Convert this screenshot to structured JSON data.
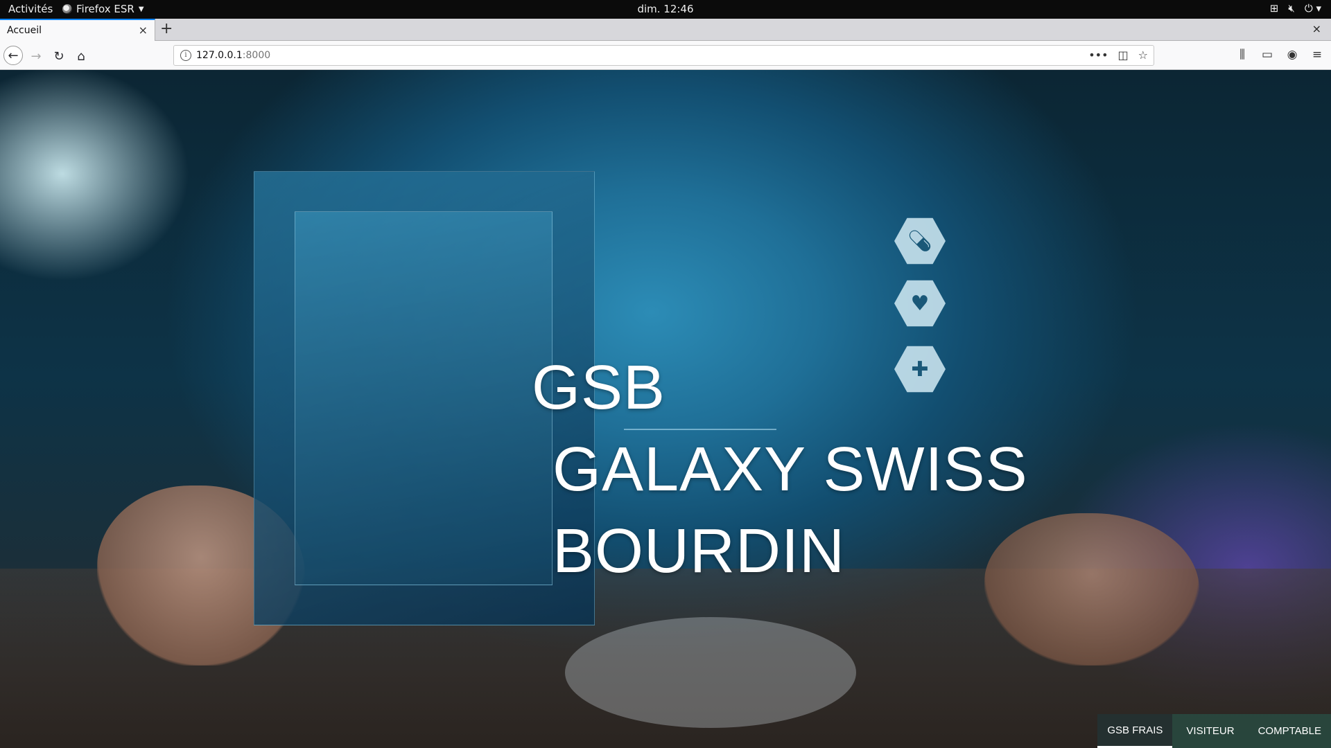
{
  "topbar": {
    "activities": "Activités",
    "app_name": "Firefox ESR",
    "clock": "dim. 12:46",
    "icons": [
      "network-icon",
      "volume-muted-icon",
      "power-icon"
    ]
  },
  "browser": {
    "tab_title": "Accueil",
    "url_host": "127.0.0.1",
    "url_port": ":8000",
    "new_tab": "+",
    "close_glyph": "×"
  },
  "hero": {
    "line1": "GSB",
    "line2": "GALAXY SWISS",
    "line3": "BOURDIN"
  },
  "menu": {
    "items": [
      {
        "label": "GSB FRAIS",
        "active": true
      },
      {
        "label": "VISITEUR",
        "active": false
      },
      {
        "label": "COMPTABLE",
        "active": false
      }
    ]
  },
  "colors": {
    "accent_tab": "#0a84ff",
    "menu_bg": "#2d5046",
    "menu_active": "#243030"
  }
}
